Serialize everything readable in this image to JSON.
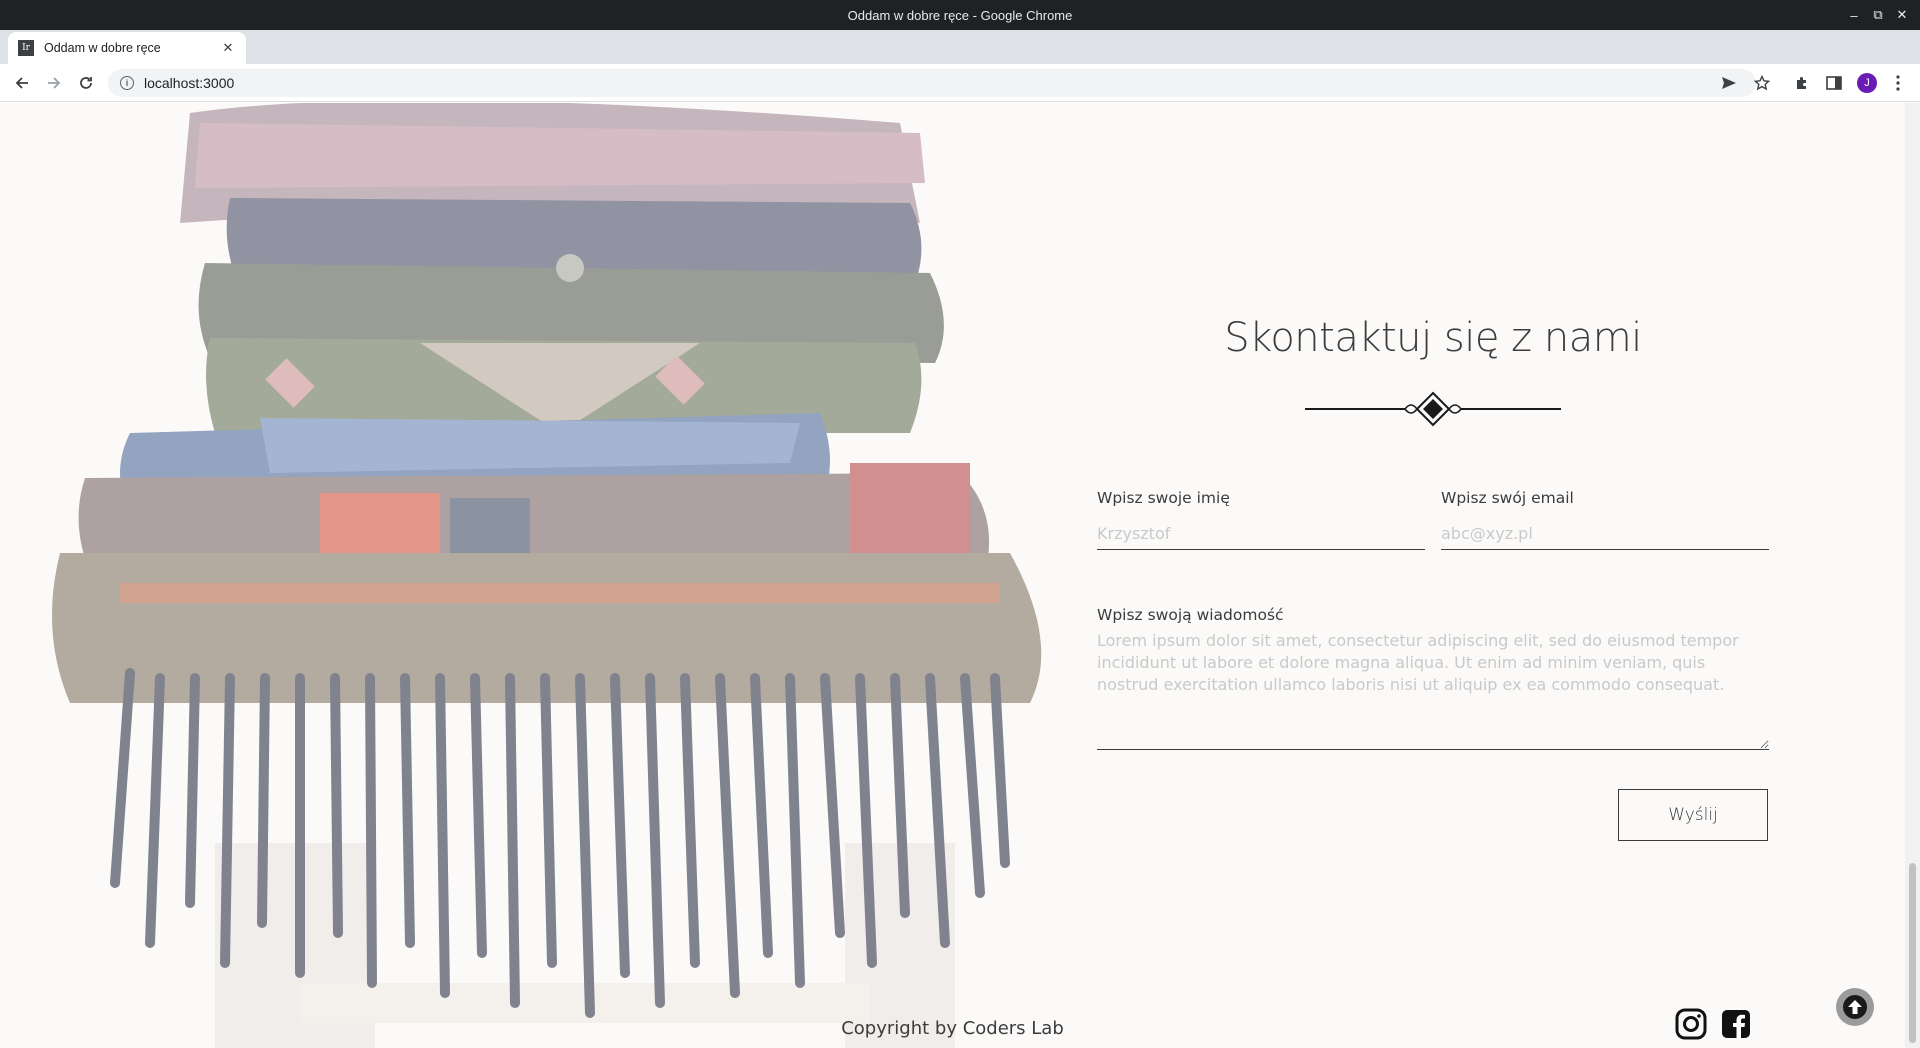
{
  "window": {
    "title": "Oddam w dobre ręce - Google Chrome",
    "controls": {
      "minimize": "–",
      "restore": "⧉",
      "close": "✕"
    }
  },
  "tab": {
    "title": "Oddam w dobre ręce",
    "favicon_text": "Ir",
    "close": "✕"
  },
  "toolbar": {
    "url": "localhost:3000",
    "back": "←",
    "forward": "→",
    "reload": "⟳",
    "avatar_initial": "J"
  },
  "contact": {
    "title": "Skontaktuj się z nami",
    "name_label": "Wpisz swoje imię",
    "name_placeholder": "Krzysztof",
    "email_label": "Wpisz swój email",
    "email_placeholder": "abc@xyz.pl",
    "message_label": "Wpisz swoją wiadomość",
    "message_placeholder": "Lorem ipsum dolor sit amet, consectetur adipiscing elit, sed do eiusmod tempor incididunt ut labore et dolore magna aliqua. Ut enim ad minim veniam, quis nostrud exercitation ullamco laboris nisi ut aliquip ex ea commodo consequat.",
    "send_label": "Wyślij"
  },
  "footer": {
    "copyright": "Copyright by Coders Lab",
    "social": [
      "instagram-icon",
      "facebook-icon"
    ]
  }
}
